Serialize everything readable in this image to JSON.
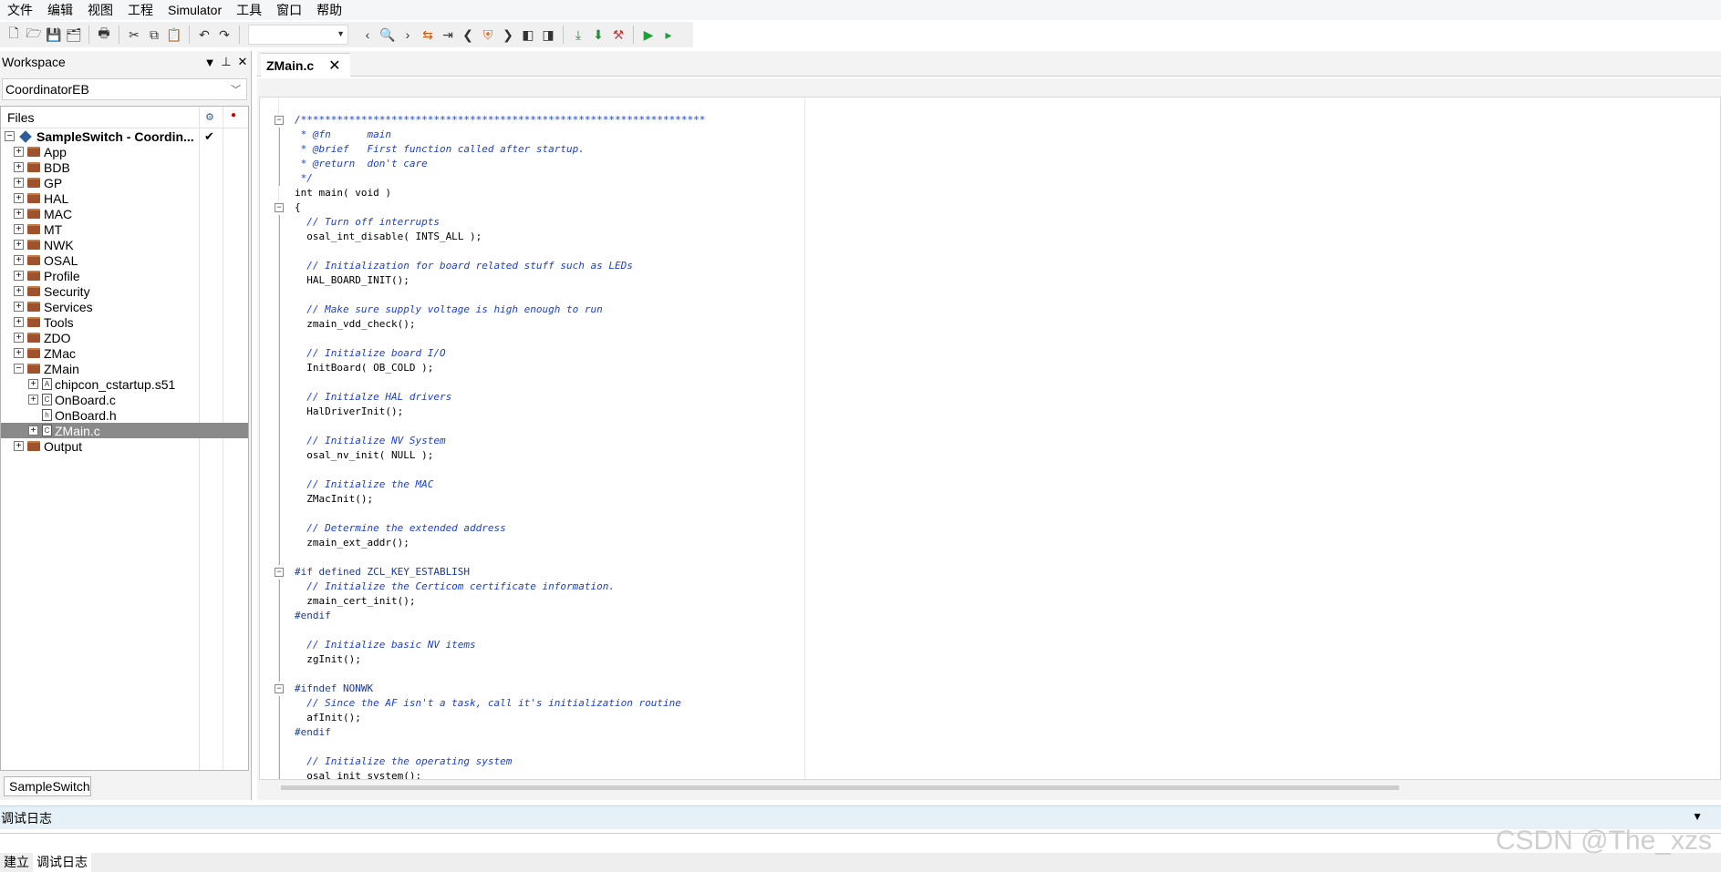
{
  "menu": [
    "文件",
    "编辑",
    "视图",
    "工程",
    "Simulator",
    "工具",
    "窗口",
    "帮助"
  ],
  "toolbar": {
    "icons": [
      "new-file-icon",
      "open-file-icon",
      "save-icon",
      "save-all-icon",
      "print-icon",
      "cut-icon",
      "copy-icon",
      "paste-icon",
      "undo-icon",
      "redo-icon"
    ],
    "icons2": [
      "back-icon",
      "find-icon",
      "forward-icon",
      "toggle-bookmark-icon",
      "goto-icon",
      "prev-icon",
      "bookmark-shield-icon",
      "next-icon",
      "prev-file-icon",
      "next-file-icon",
      "download-icon",
      "download-debug-icon",
      "make-icon",
      "debug-start-icon",
      "run-icon"
    ],
    "search_value": ""
  },
  "workspace": {
    "title": "Workspace",
    "config": "CoordinatorEB",
    "files_header": "Files",
    "project": "SampleSwitch - Coordin...",
    "tab": "SampleSwitch",
    "items": [
      {
        "label": "App",
        "type": "folder"
      },
      {
        "label": "BDB",
        "type": "folder"
      },
      {
        "label": "GP",
        "type": "folder"
      },
      {
        "label": "HAL",
        "type": "folder"
      },
      {
        "label": "MAC",
        "type": "folder"
      },
      {
        "label": "MT",
        "type": "folder"
      },
      {
        "label": "NWK",
        "type": "folder"
      },
      {
        "label": "OSAL",
        "type": "folder"
      },
      {
        "label": "Profile",
        "type": "folder"
      },
      {
        "label": "Security",
        "type": "folder"
      },
      {
        "label": "Services",
        "type": "folder"
      },
      {
        "label": "Tools",
        "type": "folder"
      },
      {
        "label": "ZDO",
        "type": "folder"
      },
      {
        "label": "ZMac",
        "type": "folder"
      },
      {
        "label": "ZMain",
        "type": "folder-open"
      }
    ],
    "zmain_children": [
      {
        "label": "chipcon_cstartup.s51",
        "icon": "A"
      },
      {
        "label": "OnBoard.c",
        "icon": "C"
      },
      {
        "label": "OnBoard.h",
        "icon": "h"
      },
      {
        "label": "ZMain.c",
        "icon": "C"
      }
    ],
    "last": {
      "label": "Output"
    }
  },
  "editor": {
    "tab": "ZMain.c",
    "lines": [
      {
        "text": "/*******************************************************************",
        "kind": "comment",
        "fold": "box"
      },
      {
        "text": " * @fn      main",
        "kind": "comment",
        "fold": "line"
      },
      {
        "text": " * @brief   First function called after startup.",
        "kind": "comment",
        "fold": "line"
      },
      {
        "text": " * @return  don't care",
        "kind": "comment",
        "fold": "line"
      },
      {
        "text": " */",
        "kind": "comment",
        "fold": "line"
      },
      {
        "text": "int main( void )",
        "kind": "code",
        "fold": ""
      },
      {
        "text": "{",
        "kind": "code",
        "fold": "box"
      },
      {
        "text": "  // Turn off interrupts",
        "kind": "comment",
        "fold": "line"
      },
      {
        "text": "  osal_int_disable( INTS_ALL );",
        "kind": "code",
        "fold": "line"
      },
      {
        "text": "",
        "kind": "code",
        "fold": "line"
      },
      {
        "text": "  // Initialization for board related stuff such as LEDs",
        "kind": "comment",
        "fold": "line"
      },
      {
        "text": "  HAL_BOARD_INIT();",
        "kind": "code",
        "fold": "line"
      },
      {
        "text": "",
        "kind": "code",
        "fold": "line"
      },
      {
        "text": "  // Make sure supply voltage is high enough to run",
        "kind": "comment",
        "fold": "line"
      },
      {
        "text": "  zmain_vdd_check();",
        "kind": "code",
        "fold": "line"
      },
      {
        "text": "",
        "kind": "code",
        "fold": "line"
      },
      {
        "text": "  // Initialize board I/O",
        "kind": "comment",
        "fold": "line"
      },
      {
        "text": "  InitBoard( OB_COLD );",
        "kind": "code",
        "fold": "line"
      },
      {
        "text": "",
        "kind": "code",
        "fold": "line"
      },
      {
        "text": "  // Initialze HAL drivers",
        "kind": "comment",
        "fold": "line"
      },
      {
        "text": "  HalDriverInit();",
        "kind": "code",
        "fold": "line"
      },
      {
        "text": "",
        "kind": "code",
        "fold": "line"
      },
      {
        "text": "  // Initialize NV System",
        "kind": "comment",
        "fold": "line"
      },
      {
        "text": "  osal_nv_init( NULL );",
        "kind": "code",
        "fold": "line"
      },
      {
        "text": "",
        "kind": "code",
        "fold": "line"
      },
      {
        "text": "  // Initialize the MAC",
        "kind": "comment",
        "fold": "line"
      },
      {
        "text": "  ZMacInit();",
        "kind": "code",
        "fold": "line"
      },
      {
        "text": "",
        "kind": "code",
        "fold": "line"
      },
      {
        "text": "  // Determine the extended address",
        "kind": "comment",
        "fold": "line"
      },
      {
        "text": "  zmain_ext_addr();",
        "kind": "code",
        "fold": "line"
      },
      {
        "text": "",
        "kind": "code",
        "fold": "line"
      },
      {
        "text": "#if defined ZCL_KEY_ESTABLISH",
        "kind": "pre",
        "fold": "box"
      },
      {
        "text": "  // Initialize the Certicom certificate information.",
        "kind": "comment",
        "fold": "line"
      },
      {
        "text": "  zmain_cert_init();",
        "kind": "code",
        "fold": "line"
      },
      {
        "text": "#endif",
        "kind": "pre",
        "fold": "line"
      },
      {
        "text": "",
        "kind": "code",
        "fold": "line"
      },
      {
        "text": "  // Initialize basic NV items",
        "kind": "comment",
        "fold": "line"
      },
      {
        "text": "  zgInit();",
        "kind": "code",
        "fold": "line"
      },
      {
        "text": "",
        "kind": "code",
        "fold": "line"
      },
      {
        "text": "#ifndef NONWK",
        "kind": "pre",
        "fold": "box"
      },
      {
        "text": "  // Since the AF isn't a task, call it's initialization routine",
        "kind": "comment",
        "fold": "line"
      },
      {
        "text": "  afInit();",
        "kind": "code",
        "fold": "line"
      },
      {
        "text": "#endif",
        "kind": "pre",
        "fold": "line"
      },
      {
        "text": "",
        "kind": "code",
        "fold": "line"
      },
      {
        "text": "  // Initialize the operating system",
        "kind": "comment",
        "fold": "line"
      },
      {
        "text": "  osal_init_system();",
        "kind": "code",
        "fold": "line"
      }
    ]
  },
  "debug": {
    "title": "调试日志",
    "tabs": [
      "建立",
      "调试日志"
    ],
    "watermark": "CSDN @The_xzs"
  }
}
